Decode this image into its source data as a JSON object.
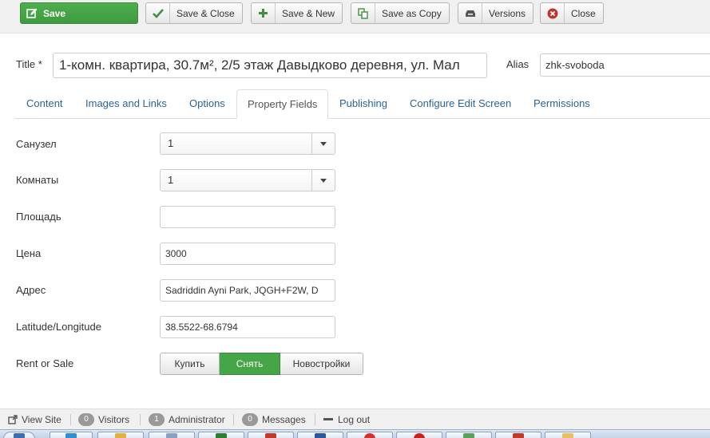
{
  "toolbar": {
    "save_label": "Save",
    "save_close_label": "Save & Close",
    "save_new_label": "Save & New",
    "save_copy_label": "Save as Copy",
    "versions_label": "Versions",
    "close_label": "Close"
  },
  "header": {
    "title_label": "Title *",
    "title_value": "1-комн. квартира, 30.7м², 2/5 этаж Давыдково деревня, ул. Мал",
    "alias_label": "Alias",
    "alias_value": "zhk-svoboda"
  },
  "tabs": [
    {
      "label": "Content"
    },
    {
      "label": "Images and Links"
    },
    {
      "label": "Options"
    },
    {
      "label": "Property Fields"
    },
    {
      "label": "Publishing"
    },
    {
      "label": "Configure Edit Screen"
    },
    {
      "label": "Permissions"
    }
  ],
  "active_tab": "Property Fields",
  "fields": {
    "bathroom": {
      "label": "Санузел",
      "value": "1"
    },
    "rooms": {
      "label": "Комнаты",
      "value": "1"
    },
    "area": {
      "label": "Площадь",
      "value": ""
    },
    "price": {
      "label": "Цена",
      "value": "3000"
    },
    "address": {
      "label": "Адрес",
      "value": "Sadriddin Ayni Park, JQGH+F2W, D"
    },
    "latlng": {
      "label": "Latitude/Longitude",
      "value": "38.5522-68.6794"
    },
    "rent_sale": {
      "label": "Rent or Sale",
      "options": [
        "Купить",
        "Снять",
        "Новостройки"
      ],
      "selected": "Снять"
    }
  },
  "statusbar": {
    "view_site": "View Site",
    "visitors_count": "0",
    "visitors_label": "Visitors",
    "admin_count": "1",
    "admin_label": "Administrator",
    "messages_count": "0",
    "messages_label": "Messages",
    "logout": "Log out"
  },
  "colors": {
    "save_green": "#46a546",
    "link_blue": "#2a6496",
    "close_red": "#bd362f"
  }
}
